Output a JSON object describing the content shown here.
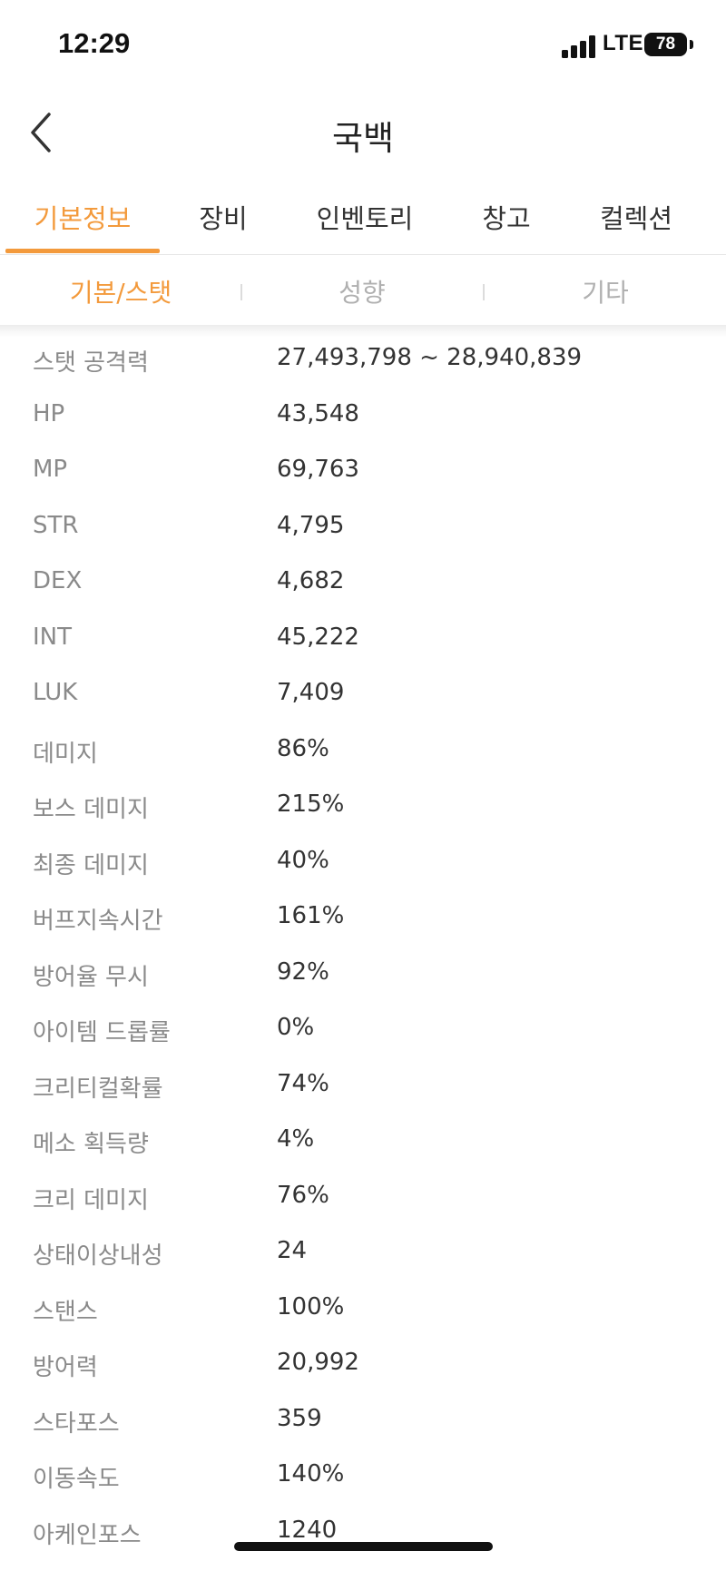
{
  "status_bar": {
    "time": "12:29",
    "network": "LTE",
    "battery": "78"
  },
  "header": {
    "title": "국백",
    "back_icon": "chevron-left-icon"
  },
  "tabs": [
    {
      "label": "기본정보",
      "active": true
    },
    {
      "label": "장비",
      "active": false
    },
    {
      "label": "인벤토리",
      "active": false
    },
    {
      "label": "창고",
      "active": false
    },
    {
      "label": "컬렉션",
      "active": false
    }
  ],
  "subtabs": [
    {
      "label": "기본/스탯",
      "active": true
    },
    {
      "label": "성향",
      "active": false
    },
    {
      "label": "기타",
      "active": false
    }
  ],
  "stats": [
    {
      "label": "스탯 공격력",
      "value": "27,493,798 ~ 28,940,839"
    },
    {
      "label": "HP",
      "value": "43,548"
    },
    {
      "label": "MP",
      "value": "69,763"
    },
    {
      "label": "STR",
      "value": "4,795"
    },
    {
      "label": "DEX",
      "value": "4,682"
    },
    {
      "label": "INT",
      "value": "45,222"
    },
    {
      "label": "LUK",
      "value": "7,409"
    },
    {
      "label": "데미지",
      "value": "86%"
    },
    {
      "label": "보스 데미지",
      "value": "215%"
    },
    {
      "label": "최종 데미지",
      "value": "40%"
    },
    {
      "label": "버프지속시간",
      "value": "161%"
    },
    {
      "label": "방어율 무시",
      "value": "92%"
    },
    {
      "label": "아이템 드롭률",
      "value": "0%"
    },
    {
      "label": "크리티컬확률",
      "value": "74%"
    },
    {
      "label": "메소 획득량",
      "value": "4%"
    },
    {
      "label": "크리 데미지",
      "value": "76%"
    },
    {
      "label": "상태이상내성",
      "value": "24"
    },
    {
      "label": "스탠스",
      "value": "100%"
    },
    {
      "label": "방어력",
      "value": "20,992"
    },
    {
      "label": "스타포스",
      "value": "359"
    },
    {
      "label": "이동속도",
      "value": "140%"
    },
    {
      "label": "아케인포스",
      "value": "1240"
    }
  ],
  "colors": {
    "accent": "#f39a3c",
    "label": "#8a8a8a",
    "value": "#333333",
    "inactive_subtab": "#b0b0b0"
  }
}
